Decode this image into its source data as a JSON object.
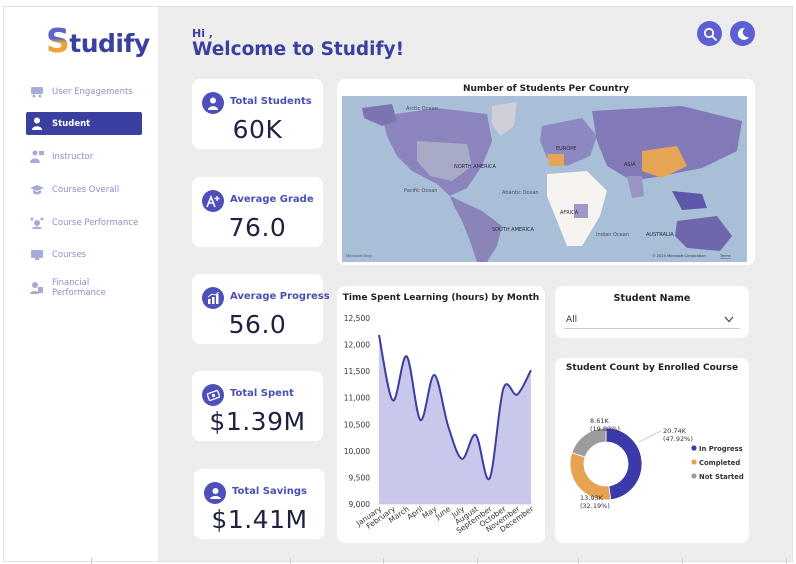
{
  "app": {
    "logo_initial": "S",
    "logo_rest": "tudify"
  },
  "sidebar": {
    "items": [
      {
        "label": "User Engagements",
        "icon": "engagement-icon",
        "active": false
      },
      {
        "label": "Student",
        "icon": "student-icon",
        "active": true
      },
      {
        "label": "Instructor",
        "icon": "instructor-icon",
        "active": false
      },
      {
        "label": "Courses Overall",
        "icon": "graduation-cap-icon",
        "active": false
      },
      {
        "label": "Course Performance",
        "icon": "performance-icon",
        "active": false
      },
      {
        "label": "Courses",
        "icon": "monitor-icon",
        "active": false
      },
      {
        "label": "Financial Performance",
        "icon": "finance-icon",
        "active": false
      }
    ]
  },
  "header": {
    "hi": "Hi ,",
    "welcome": "Welcome to Studify!"
  },
  "toolbar": {
    "search_icon": "search-icon",
    "theme_icon": "moon-icon"
  },
  "colors": {
    "accent": "#3a3fa0",
    "area_fill": "#c9c8ec",
    "line": "#3b3f9e",
    "in_progress": "#3b3aa8",
    "completed": "#e8a352",
    "not_started": "#9c9c9c"
  },
  "kpis": [
    {
      "label": "Total Students",
      "value": "60K",
      "icon": "student-icon"
    },
    {
      "label": "Average Grade",
      "value": "76.0",
      "icon": "grade-plus-icon"
    },
    {
      "label": "Average Progress",
      "value": "56.0",
      "icon": "progress-chart-icon"
    },
    {
      "label": "Total Spent",
      "value": "$1.39M",
      "icon": "money-icon"
    },
    {
      "label": "Total Savings",
      "value": "$1.41M",
      "icon": "savings-icon"
    }
  ],
  "map": {
    "title": "Number of Students Per Country",
    "labels": {
      "arctic": "Arctic Ocean",
      "north_america": "NORTH AMERICA",
      "europe": "EUROPE",
      "asia": "ASIA",
      "pacific": "Pacific Ocean",
      "atlantic": "Atlantic Ocean",
      "africa": "AFRICA",
      "south_america": "SOUTH AMERICA",
      "indian": "Indian Ocean",
      "australia": "AUSTRALIA"
    },
    "bing": "Microsoft Bing",
    "copyright": "© 2025 Microsoft Corporation",
    "terms": "Terms"
  },
  "filter": {
    "title": "Student Name",
    "selected": "All"
  },
  "chart_data": [
    {
      "type": "area",
      "title": "Time Spent Learning (hours) by Month",
      "xlabel": "",
      "ylabel": "",
      "categories": [
        "January",
        "February",
        "March",
        "April",
        "May",
        "June",
        "July",
        "August",
        "September",
        "October",
        "November",
        "December"
      ],
      "values": [
        12180,
        10950,
        11780,
        10580,
        11430,
        10470,
        9850,
        10300,
        9480,
        11170,
        11060,
        11520
      ],
      "ylim": [
        9000,
        12500
      ],
      "yticks": [
        "12,500",
        "12,000",
        "11,500",
        "11,000",
        "10,500",
        "10,000",
        "9,500",
        "9,000"
      ]
    },
    {
      "type": "pie",
      "title": "Student Count by Enrolled Course",
      "series": [
        {
          "name": "In Progress",
          "value": 20.74,
          "label": "20.74K",
          "pct": "(47.92%)"
        },
        {
          "name": "Completed",
          "value": 13.93,
          "label": "13.93K",
          "pct": "(32.19%)"
        },
        {
          "name": "Not Started",
          "value": 8.61,
          "label": "8.61K",
          "pct": "(19.89%)"
        }
      ]
    }
  ]
}
